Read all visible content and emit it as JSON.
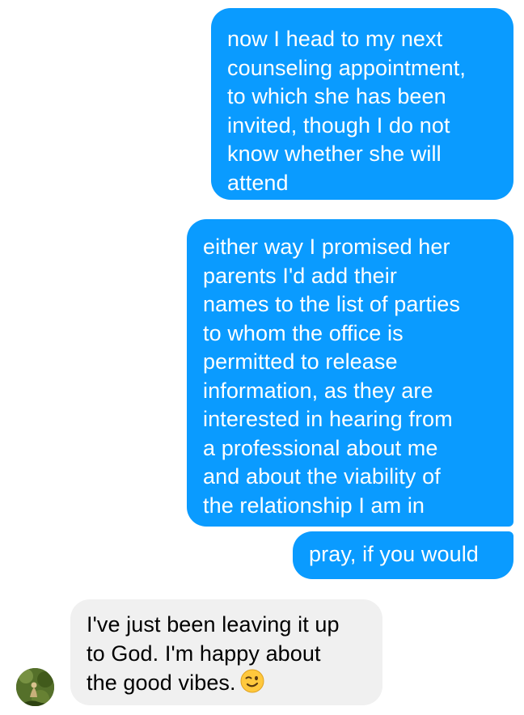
{
  "messages": [
    {
      "direction": "outgoing",
      "text": "now I head to my next\ncounseling appointment,\nto which she has been\ninvited, though I do not\nknow whether she will\nattend"
    },
    {
      "direction": "outgoing",
      "text": "either way I promised her\nparents I'd add their\nnames to the list of parties\nto whom the office is\npermitted to release\ninformation, as they are\ninterested in hearing from\na professional about me\nand about the viability of\nthe relationship I am in"
    },
    {
      "direction": "outgoing",
      "text": "pray, if you would"
    },
    {
      "direction": "incoming",
      "text": "I've just been leaving it up\nto God. I'm happy about\nthe good vibes.",
      "emoji": "winking-face-emoji"
    }
  ],
  "colors": {
    "outgoing_bubble": "#0a9bff",
    "incoming_bubble": "#f0f0f0",
    "outgoing_text": "#ffffff",
    "incoming_text": "#000000"
  },
  "icons": {
    "avatar": "contact-avatar-photo"
  }
}
